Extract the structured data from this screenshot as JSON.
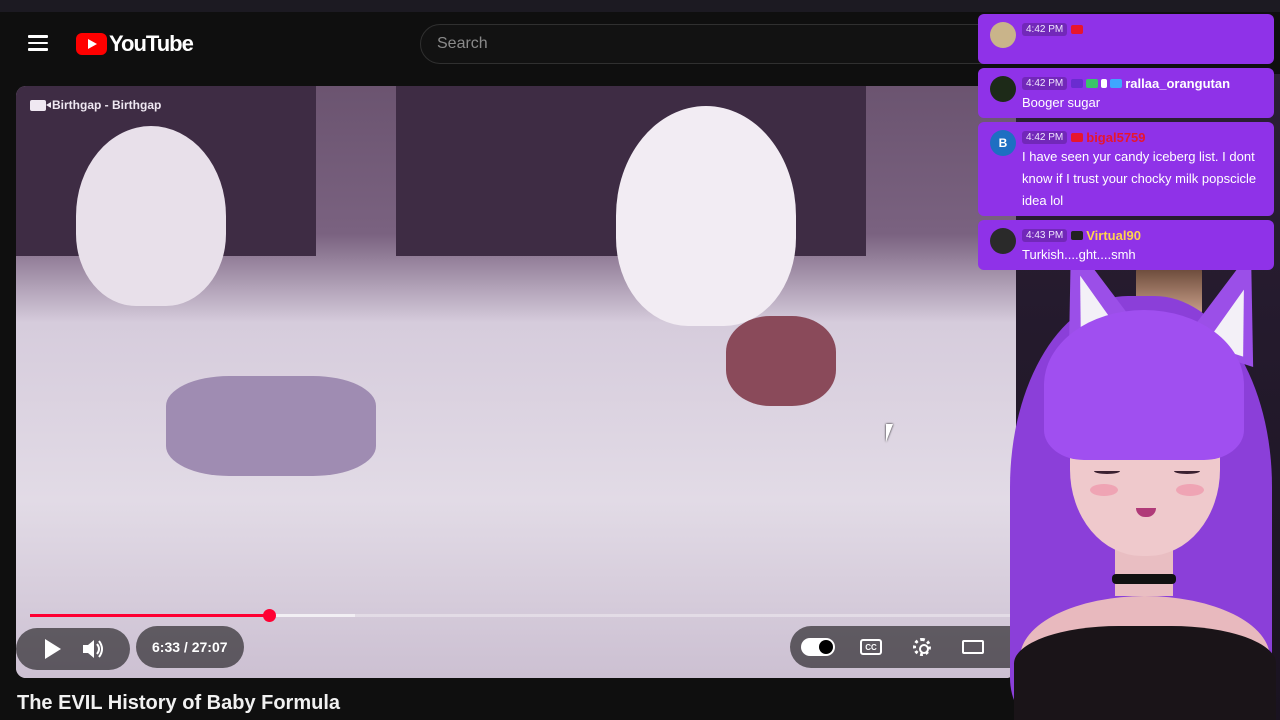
{
  "masthead": {
    "logo_text": "YouTube",
    "search_placeholder": "Search"
  },
  "player": {
    "watermark": "Birthgap - Birthgap",
    "current_time": "6:33",
    "separator": " / ",
    "duration": "27:07",
    "progress_fraction": 0.242,
    "buffer_fraction": 0.33,
    "cc_label": "CC"
  },
  "video": {
    "title": "The EVIL History of Baby Formula"
  },
  "chat": {
    "messages": [
      {
        "time": "4:42 PM",
        "user": "",
        "text": "",
        "avatar": "",
        "user_color": "#e8162d",
        "avatar_color": "#c9b48a"
      },
      {
        "time": "4:42 PM",
        "user": "rallaa_orangutan",
        "text": "Booger sugar",
        "avatar": "",
        "user_color": "#ffffff",
        "avatar_color": "#1d2a18"
      },
      {
        "time": "4:42 PM",
        "user": "bigal5759",
        "text": "I have seen yur candy iceberg list. I dont know if I trust your chocky milk popscicle idea lol",
        "avatar": "B",
        "user_color": "#e8162d",
        "avatar_color": "#1e6fc2"
      },
      {
        "time": "4:43 PM",
        "user": "Virtual90",
        "text": "Turkish....ght....smh",
        "avatar": "",
        "user_color": "#ffd34d",
        "avatar_color": "#2a2a2a"
      }
    ]
  },
  "colors": {
    "accent_red": "#ff0033",
    "chat_bg": "#8f32e8",
    "youtube_red": "#ff0000"
  },
  "icons": [
    "menu-icon",
    "youtube-logo-icon",
    "camera-icon",
    "play-icon",
    "volume-icon",
    "autoplay-toggle-icon",
    "captions-icon",
    "settings-icon",
    "theater-mode-icon",
    "mouse-cursor-icon"
  ]
}
